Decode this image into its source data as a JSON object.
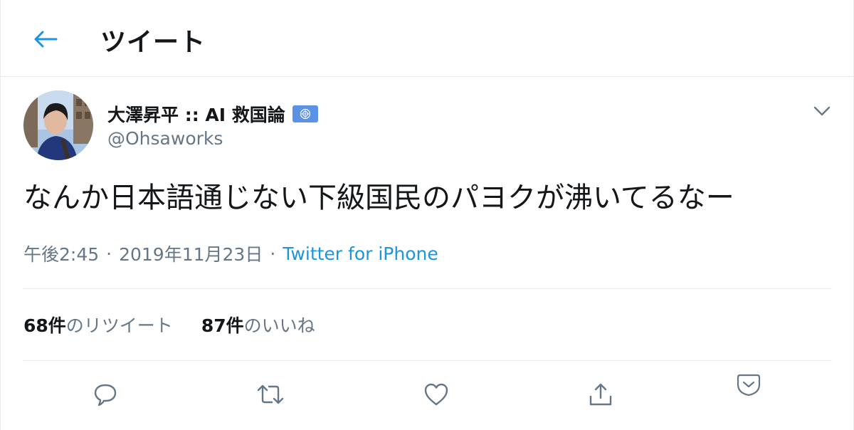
{
  "header": {
    "title": "ツイート",
    "back_icon": "arrow-left-icon"
  },
  "colors": {
    "accent": "#1b95e0",
    "secondary_text": "#657786",
    "primary_text": "#14171a",
    "divider": "#e6ecf0",
    "badge": "#5b92e5"
  },
  "author": {
    "display_name": "大澤昇平 :: AI 救国論",
    "badge_icon": "un-flag-icon",
    "handle": "@Ohsaworks"
  },
  "tweet": {
    "text": "なんか日本語通じない下級国民のパヨクが沸いてるなー"
  },
  "meta": {
    "time": "午後2:45",
    "separator": "·",
    "date": "2019年11月23日",
    "source": "Twitter for iPhone"
  },
  "stats": {
    "retweets_count": "68件",
    "retweets_label": "のリツイート",
    "likes_count": "87件",
    "likes_label": "のいいね"
  },
  "actions": [
    "reply-icon",
    "retweet-icon",
    "like-icon",
    "share-icon",
    "more-caret-icon"
  ]
}
